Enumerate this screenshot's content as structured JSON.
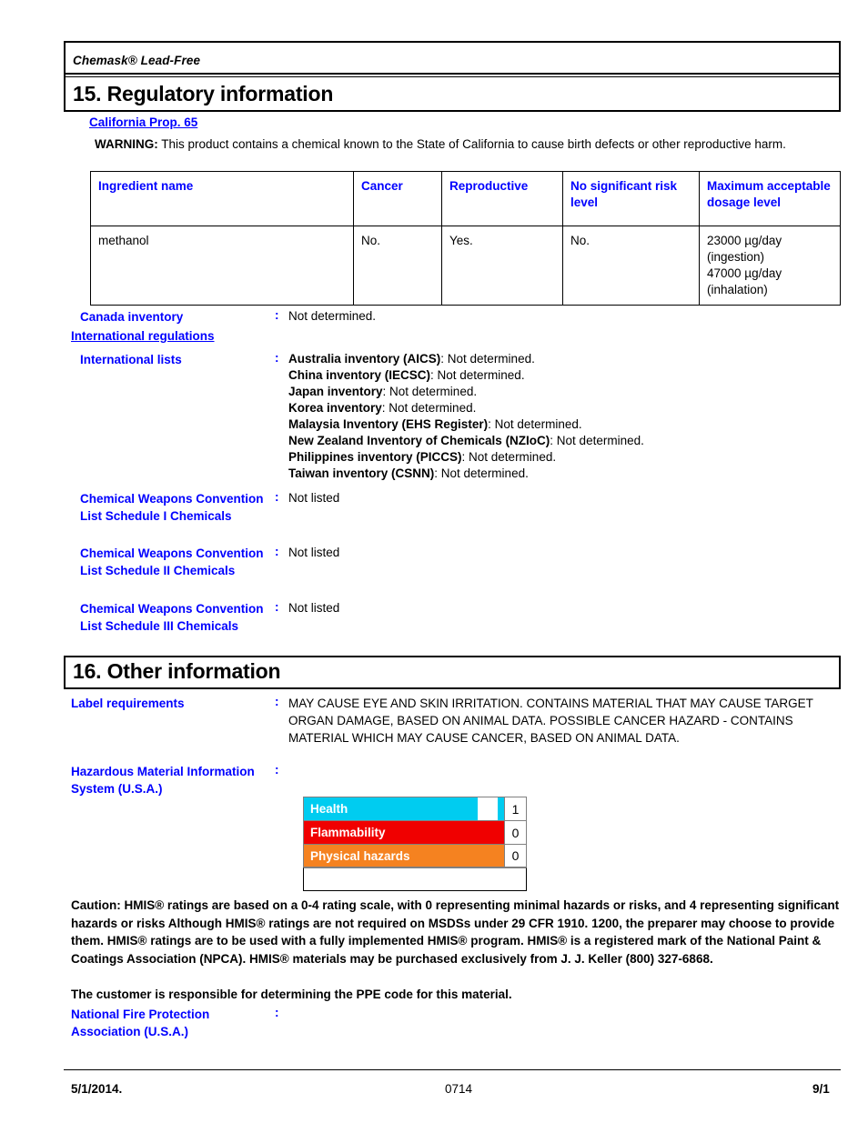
{
  "document": {
    "product_name": "Chemask® Lead-Free"
  },
  "section15": {
    "heading": "15. Regulatory information",
    "prop65": {
      "link_label": "California Prop. 65",
      "warning_lead": "WARNING:",
      "warning_text": " This product contains a chemical known to the State of California to cause birth defects or other reproductive harm.",
      "table": {
        "headers": [
          "Ingredient name",
          "Cancer",
          "Reproductive",
          "No significant risk level",
          "Maximum acceptable dosage level"
        ],
        "rows": [
          {
            "ingredient": "methanol",
            "cancer": "No.",
            "reproductive": "Yes.",
            "no_significant_risk_level": "No.",
            "maximum_acceptable_dosage_level": "23000 µg/day (ingestion)\n47000 µg/day (inhalation)"
          }
        ]
      }
    },
    "canada_inventory": {
      "label": "Canada inventory",
      "colon": ":",
      "value": "Not determined."
    },
    "international_regulations_heading": "International regulations",
    "international_lists": {
      "label": "International lists",
      "colon": ":",
      "entries": [
        {
          "name": "Australia inventory (AICS)",
          "value": ": Not determined."
        },
        {
          "name": "China inventory (IECSC)",
          "value": ": Not determined."
        },
        {
          "name": "Japan inventory",
          "value": ": Not determined."
        },
        {
          "name": "Korea inventory",
          "value": ": Not determined."
        },
        {
          "name": "Malaysia Inventory (EHS Register)",
          "value": ": Not determined."
        },
        {
          "name": "New Zealand Inventory of Chemicals (NZIoC)",
          "value": ": Not determined."
        },
        {
          "name": "Philippines inventory (PICCS)",
          "value": ": Not determined."
        },
        {
          "name": "Taiwan inventory (CSNN)",
          "value": ": Not determined."
        }
      ]
    },
    "cwc_schedules": [
      {
        "label": "Chemical Weapons Convention List Schedule I Chemicals",
        "colon": ":",
        "value": "Not listed"
      },
      {
        "label": "Chemical Weapons Convention List Schedule II Chemicals",
        "colon": ":",
        "value": "Not listed"
      },
      {
        "label": "Chemical Weapons Convention List Schedule III Chemicals",
        "colon": ":",
        "value": "Not listed"
      }
    ]
  },
  "section16": {
    "heading": "16. Other information",
    "label_requirements": {
      "label": "Label requirements",
      "colon": ":",
      "value": "MAY CAUSE EYE AND SKIN IRRITATION.  CONTAINS MATERIAL THAT MAY CAUSE TARGET ORGAN DAMAGE, BASED ON ANIMAL DATA.  POSSIBLE CANCER HAZARD - CONTAINS MATERIAL WHICH MAY CAUSE CANCER, BASED ON ANIMAL DATA."
    },
    "hmis": {
      "label": "Hazardous Material Information System (U.S.A.)",
      "colon": ":",
      "rows": [
        {
          "name": "Health",
          "value": "1",
          "color": "#00ccf0",
          "fill_percent": 87
        },
        {
          "name": "Flammability",
          "value": "0",
          "color": "#f00000",
          "fill_percent": 100
        },
        {
          "name": "Physical hazards",
          "value": "0",
          "color": "#f58220",
          "fill_percent": 100
        }
      ]
    },
    "caution_text": "Caution: HMIS® ratings are based on a 0-4 rating scale, with 0 representing minimal hazards or risks, and 4 representing significant hazards or risks Although HMIS® ratings are not required on MSDSs under 29 CFR 1910. 1200, the preparer may choose to provide them. HMIS® ratings are to be used with a fully implemented HMIS® program. HMIS® is a registered mark of the National Paint & Coatings Association (NPCA). HMIS® materials may be purchased exclusively from J. J. Keller (800) 327-6868.",
    "ppe_text": "The customer is responsible for determining the PPE code for this material.",
    "nfpa": {
      "label": "National Fire Protection Association (U.S.A.)",
      "colon": ":",
      "value": ""
    }
  },
  "footer": {
    "date": "5/1/2014.",
    "code": "0714",
    "page": "9/1"
  }
}
